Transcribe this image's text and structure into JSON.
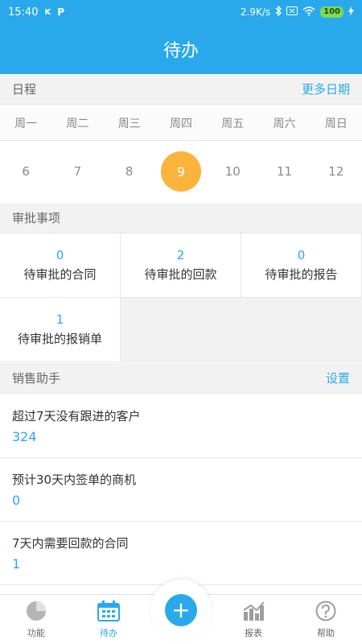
{
  "status": {
    "time": "15:40",
    "k_icon": "K",
    "p_icon": "P",
    "network_speed": "2.9K/s",
    "battery": "100"
  },
  "header": {
    "title": "待办"
  },
  "schedule": {
    "title": "日程",
    "more_label": "更多日期",
    "weekdays": [
      "周一",
      "周二",
      "周三",
      "周四",
      "周五",
      "周六",
      "周日"
    ],
    "dates": [
      "6",
      "7",
      "8",
      "9",
      "10",
      "11",
      "12"
    ],
    "selected_index": 3
  },
  "approval": {
    "title": "审批事项",
    "items": [
      {
        "count": "0",
        "label": "待审批的合同"
      },
      {
        "count": "2",
        "label": "待审批的回款"
      },
      {
        "count": "0",
        "label": "待审批的报告"
      },
      {
        "count": "1",
        "label": "待审批的报销单"
      }
    ]
  },
  "sales": {
    "title": "销售助手",
    "settings_label": "设置",
    "items": [
      {
        "title": "超过7天没有跟进的客户",
        "value": "324"
      },
      {
        "title": "预计30天内签单的商机",
        "value": "0"
      },
      {
        "title": "7天内需要回款的合同",
        "value": "1"
      }
    ]
  },
  "tabs": {
    "features": "功能",
    "todo": "待办",
    "add": "+",
    "reports": "报表",
    "help": "帮助"
  },
  "colors": {
    "primary": "#29a9ec",
    "selected_date": "#fbb33b"
  }
}
